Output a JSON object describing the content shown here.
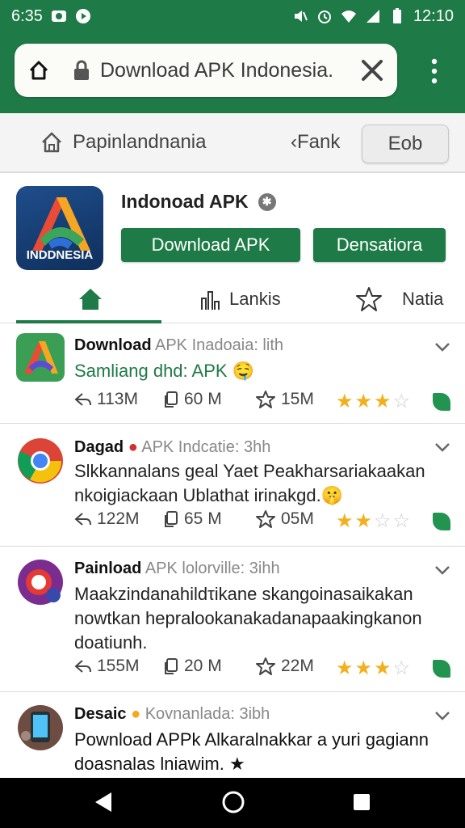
{
  "status": {
    "time_left": "6:35",
    "time_right": "12:10",
    "left_icons": [
      "message-icon",
      "play-icon"
    ],
    "right_icons": [
      "mute-icon",
      "alarm-icon",
      "wifi-icon",
      "signal-icon",
      "battery-icon"
    ]
  },
  "browser": {
    "url": "Download APK Indonesia.",
    "icons": [
      "home-icon",
      "lock-icon",
      "close-icon",
      "more-vert-icon"
    ],
    "accent": "#1e7a46"
  },
  "subnav": {
    "home_label": "Papinlandnania",
    "back_label": "‹Fank",
    "button_label": "Eob"
  },
  "app": {
    "name": "Indonoad APK",
    "logo_text": "INDDNESIA",
    "primary_button": "Download APK",
    "secondary_button": "Densatiora",
    "tabs": [
      {
        "label": "",
        "icon": "home-icon"
      },
      {
        "label": "Lankis",
        "icon": "chart-icon"
      },
      {
        "label": "Natia",
        "icon": "star-icon"
      }
    ]
  },
  "feed": [
    {
      "title": "Download",
      "meta": "APK Inadoaia: lith",
      "body": "Samliang dhd: APK 🤤",
      "body_color": "#1e7a46",
      "shares": "113M",
      "copies": "60 M",
      "stars_count": "15M",
      "rating": 3
    },
    {
      "title": "Dagad",
      "meta": "APK Indcatie: 3hh",
      "body": "Slkkannalans geal Yaet Peakharsariakaakan nkoigiackaan Ublathat irinakgd.🤫",
      "body_color": "#222222",
      "shares": "122M",
      "copies": "65 M",
      "stars_count": "05M",
      "rating": 2
    },
    {
      "title": "Painload",
      "meta": "APK lolorville: 3ihh",
      "body": "Maakzindanahildτikane skangoinasaikakan nowtkan hepralookanakadanapaakingkanon doatiunh.",
      "body_color": "#222222",
      "shares": "155M",
      "copies": "20 M",
      "stars_count": "22M",
      "rating": 3
    },
    {
      "title": "Desaic",
      "meta": "Kovnanlada: 3ibh",
      "body": "Pownload APPk Alkaralnakkar a yuri gagiann doasnalas lniawim. ★",
      "body_color": "#111111",
      "shares": "",
      "copies": "",
      "stars_count": "",
      "rating": 0
    }
  ]
}
